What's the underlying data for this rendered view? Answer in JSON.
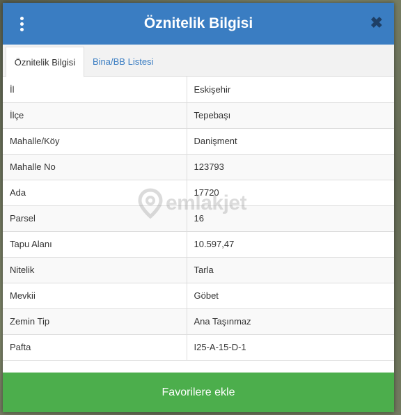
{
  "header": {
    "title": "Öznitelik Bilgisi",
    "menu_icon": "vertical-dots-icon",
    "close_icon": "close-icon",
    "close_glyph": "✖",
    "background_color": "#3a7dc2"
  },
  "tabs": [
    {
      "label": "Öznitelik Bilgisi",
      "active": true
    },
    {
      "label": "Bina/BB Listesi",
      "active": false
    }
  ],
  "attributes": [
    {
      "key": "İl",
      "value": "Eskişehir"
    },
    {
      "key": "İlçe",
      "value": "Tepebaşı"
    },
    {
      "key": "Mahalle/Köy",
      "value": "Danişment"
    },
    {
      "key": "Mahalle No",
      "value": "123793"
    },
    {
      "key": "Ada",
      "value": "17720"
    },
    {
      "key": "Parsel",
      "value": "16"
    },
    {
      "key": "Tapu Alanı",
      "value": "10.597,47"
    },
    {
      "key": "Nitelik",
      "value": "Tarla"
    },
    {
      "key": "Mevkii",
      "value": "Göbet"
    },
    {
      "key": "Zemin Tip",
      "value": "Ana Taşınmaz"
    },
    {
      "key": "Pafta",
      "value": "I25-A-15-D-1"
    }
  ],
  "footer": {
    "favorite_button_label": "Favorilere ekle",
    "button_color": "#4cae4c"
  },
  "watermark": {
    "text": "emlakjet",
    "icon": "location-pin-icon"
  }
}
